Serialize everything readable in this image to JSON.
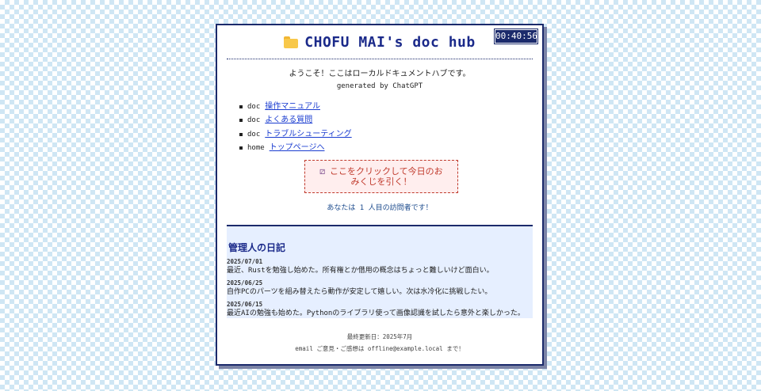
{
  "header": {
    "title": "CHOFU MAI's doc hub",
    "folder_icon": "folder-icon"
  },
  "clock": {
    "time": "00:40:56"
  },
  "intro": {
    "welcome": "ようこそ！ここはローカルドキュメントハブです。",
    "generated": "generated by ChatGPT"
  },
  "links": [
    {
      "type": "doc",
      "label": "操作マニュアル"
    },
    {
      "type": "doc",
      "label": "よくある質問"
    },
    {
      "type": "doc",
      "label": "トラブルシューティング"
    },
    {
      "type": "home",
      "label": "トップページへ"
    }
  ],
  "omikuji": {
    "icon": "dice-icon",
    "label": "ここをクリックして今日のおみくじを引く！"
  },
  "visitor": {
    "text": "あなたは 1 人目の訪問者です！"
  },
  "diary": {
    "title": "管理人の日記",
    "entries": [
      {
        "date": "2025/07/01",
        "text": "最近、Rustを勉強し始めた。所有権とか借用の概念はちょっと難しいけど面白い。"
      },
      {
        "date": "2025/06/25",
        "text": "自作PCのパーツを組み替えたら動作が安定して嬉しい。次は水冷化に挑戦したい。"
      },
      {
        "date": "2025/06/15",
        "text": "最近AIの勉強も始めた。Pythonのライブラリ使って画像認識を試したら意外と楽しかった。"
      }
    ]
  },
  "footer": {
    "updated": "最終更新日：2025年7月",
    "contact": "email  ご意見・ご感想は offline@example.local まで！"
  },
  "colors": {
    "accent": "#1b2a6b",
    "link": "#1a3cd0",
    "omikuji": "#c0392b",
    "diary_bg": "#e6efff"
  }
}
